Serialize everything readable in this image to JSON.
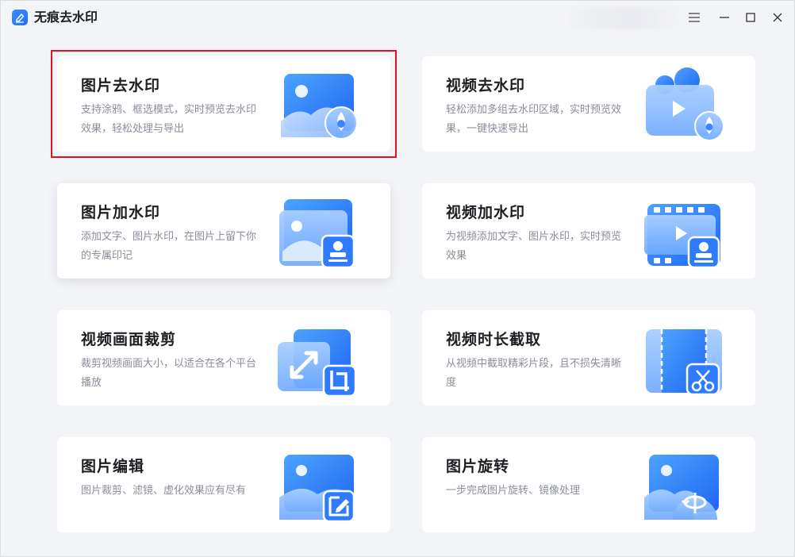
{
  "app": {
    "title": "无痕去水印",
    "accent": "#2f7bff",
    "selection_color": "#e0141e"
  },
  "window_controls": {
    "menu_icon": "menu-icon",
    "minimize_icon": "minimize-icon",
    "maximize_icon": "maximize-icon",
    "close_icon": "close-icon"
  },
  "cards": [
    {
      "id": "image-remove-watermark",
      "title": "图片去水印",
      "desc": "支持涂鸦、框选模式，实时预览去水印效果，轻松处理与导出",
      "icon": "image-remove-watermark-icon",
      "selected": true
    },
    {
      "id": "video-remove-watermark",
      "title": "视频去水印",
      "desc": "轻松添加多组去水印区域，实时预览效果，一键快速导出",
      "icon": "video-remove-watermark-icon"
    },
    {
      "id": "image-add-watermark",
      "title": "图片加水印",
      "desc": "添加文字、图片水印，在图片上留下你的专属印记",
      "icon": "image-add-watermark-icon"
    },
    {
      "id": "video-add-watermark",
      "title": "视频加水印",
      "desc": "为视频添加文字、图片水印，实时预览效果",
      "icon": "video-add-watermark-icon"
    },
    {
      "id": "video-crop",
      "title": "视频画面裁剪",
      "desc": "裁剪视频画面大小，以适合在各个平台播放",
      "icon": "video-crop-icon"
    },
    {
      "id": "video-trim",
      "title": "视频时长截取",
      "desc": "从视频中截取精彩片段，且不损失清晰度",
      "icon": "video-trim-icon"
    },
    {
      "id": "image-edit",
      "title": "图片编辑",
      "desc": "图片裁剪、滤镜、虚化效果应有尽有",
      "icon": "image-edit-icon"
    },
    {
      "id": "image-rotate",
      "title": "图片旋转",
      "desc": "一步完成图片旋转、镜像处理",
      "icon": "image-rotate-icon"
    }
  ]
}
